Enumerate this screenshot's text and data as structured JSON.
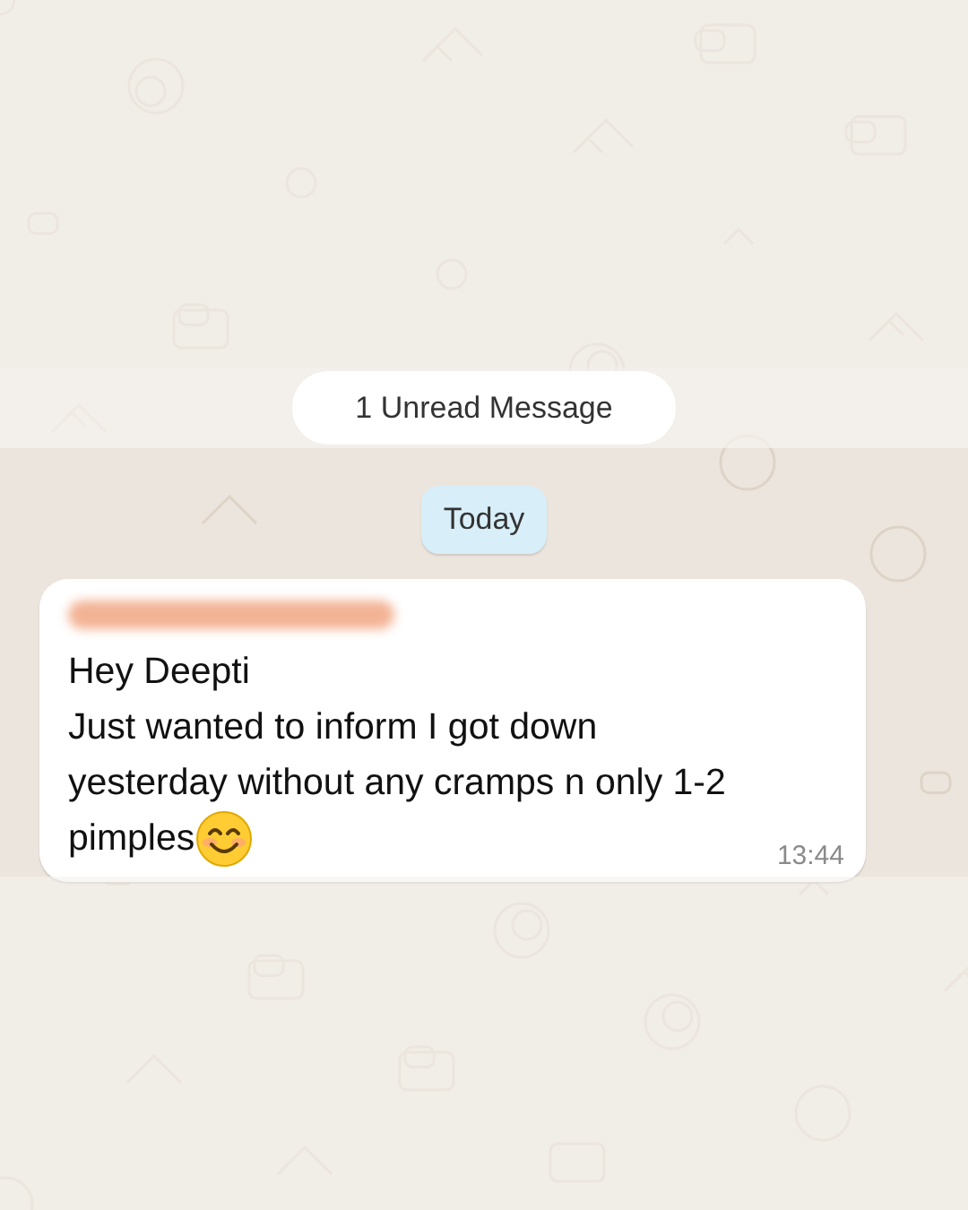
{
  "unread_banner": {
    "label": "1 Unread Message"
  },
  "date_chip": {
    "label": "Today"
  },
  "messages": [
    {
      "sender_redacted": true,
      "lines": [
        "Hey Deepti",
        "Just wanted to inform I got down",
        "yesterday without any cramps n only 1-2",
        "pimples"
      ],
      "time": "13:44"
    }
  ]
}
